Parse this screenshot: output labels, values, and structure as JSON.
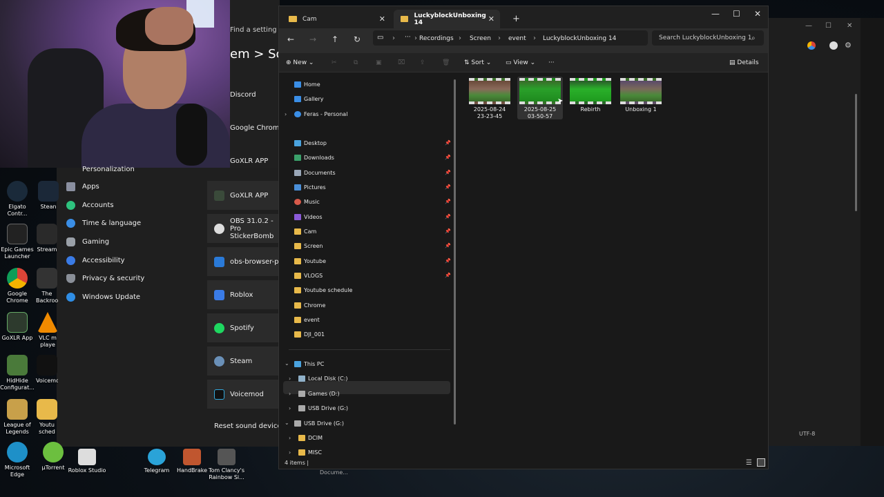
{
  "settings": {
    "search_placeholder": "Find a setting",
    "title_partial": "em  >  Sc",
    "nav": [
      "Personalization",
      "Apps",
      "Accounts",
      "Time & language",
      "Gaming",
      "Accessibility",
      "Privacy & security",
      "Windows Update"
    ],
    "apps_upper": [
      "Discord",
      "Google Chrome",
      "GoXLR APP"
    ],
    "apps": [
      "GoXLR APP",
      "OBS 31.0.2 - Pro StickerBomb",
      "obs-browser-pa",
      "Roblox",
      "Spotify",
      "Steam",
      "Voicemod"
    ],
    "reset_label": "Reset sound devices ar"
  },
  "desktop_icons": [
    {
      "label": "Elgato Contr...",
      "color": "#1a2a3a"
    },
    {
      "label": "Stean",
      "color": "#1b2838"
    },
    {
      "label": "Epic Games Launcher",
      "color": "#222"
    },
    {
      "label": "Stream",
      "color": "#2a2a2a"
    },
    {
      "label": "Google Chrome",
      "color": "#db4437"
    },
    {
      "label": "The Backroo",
      "color": "#333"
    },
    {
      "label": "GoXLR App",
      "color": "#2d3a2d"
    },
    {
      "label": "VLC m playe",
      "color": "#f08a00"
    },
    {
      "label": "HidHide Configurat...",
      "color": "#4a7a3a"
    },
    {
      "label": "Voicemo",
      "color": "#111"
    },
    {
      "label": "League of Legends",
      "color": "#c8a04a"
    },
    {
      "label": "Youtu sched",
      "color": "#e8b94a"
    },
    {
      "label": "Microsoft Edge",
      "color": "#1e90c8"
    },
    {
      "label": "µTorrent",
      "color": "#6cbf3f"
    }
  ],
  "taskbar_icons": [
    {
      "label": "Roblox Studio",
      "color": "#ddd"
    },
    {
      "label": "Telegram",
      "color": "#2aa3d8"
    },
    {
      "label": "HandBrake",
      "color": "#c0562f"
    },
    {
      "label": "Tom Clancy's Rainbow Si...",
      "color": "#555"
    }
  ],
  "explorer": {
    "tabs": [
      {
        "label": "Cam",
        "active": false
      },
      {
        "label": "LuckyblockUnboxing 14",
        "active": true
      }
    ],
    "new_tab": "+",
    "window_controls": {
      "minimize": "—",
      "maximize": "☐",
      "close": "✕"
    },
    "nav": {
      "back": "←",
      "forward": "→",
      "up": "↑",
      "refresh": "↻"
    },
    "breadcrumb": [
      "Recordings",
      "Screen",
      "event",
      "LuckyblockUnboxing 14"
    ],
    "search_placeholder": "Search LuckyblockUnboxing 1",
    "toolbar": {
      "new": "New",
      "sort": "Sort",
      "view": "View",
      "more": "···",
      "details": "Details"
    },
    "quick": [
      {
        "label": "Home",
        "color": "#3a8ee6"
      },
      {
        "label": "Gallery",
        "color": "#3a8ee6"
      },
      {
        "label": "Feras - Personal",
        "color": "#3a8ee6"
      }
    ],
    "pinned": [
      {
        "label": "Desktop",
        "color": "#4aa3df"
      },
      {
        "label": "Downloads",
        "color": "#3aa06a"
      },
      {
        "label": "Documents",
        "color": "#9aa7b8"
      },
      {
        "label": "Pictures",
        "color": "#4a8fd8"
      },
      {
        "label": "Music",
        "color": "#d85a4a"
      },
      {
        "label": "Videos",
        "color": "#8a5ad8"
      },
      {
        "label": "Cam",
        "color": "#e8b94a"
      },
      {
        "label": "Screen",
        "color": "#e8b94a"
      },
      {
        "label": "Youtube",
        "color": "#e8b94a"
      }
    ],
    "folders": [
      "VLOGS",
      "Youtube schedule",
      "Chrome",
      "event",
      "DJI_001"
    ],
    "this_pc": "This PC",
    "drives": [
      "Local Disk (C:)",
      "Games (D:)",
      "USB Drive (G:)"
    ],
    "usb_root": "USB Drive (G:)",
    "usb_children": [
      "DCIM",
      "MISC"
    ],
    "files": [
      {
        "name": "2025-08-24 23-23-45",
        "line1": "2025-08-24",
        "line2": "23-23-45",
        "thumb": "scene"
      },
      {
        "name": "2025-08-25 03-50-57",
        "line1": "2025-08-25",
        "line2": "03-50-57",
        "thumb": "green"
      },
      {
        "name": "Rebirth",
        "line1": "Rebirth",
        "line2": "",
        "thumb": "green"
      },
      {
        "name": "Unboxing 1",
        "line1": "Unboxing 1",
        "line2": "",
        "thumb": "scene"
      }
    ],
    "status": "4 items  |"
  },
  "tooltip_partial": "Docume...",
  "chrome_status": "UTF-8"
}
